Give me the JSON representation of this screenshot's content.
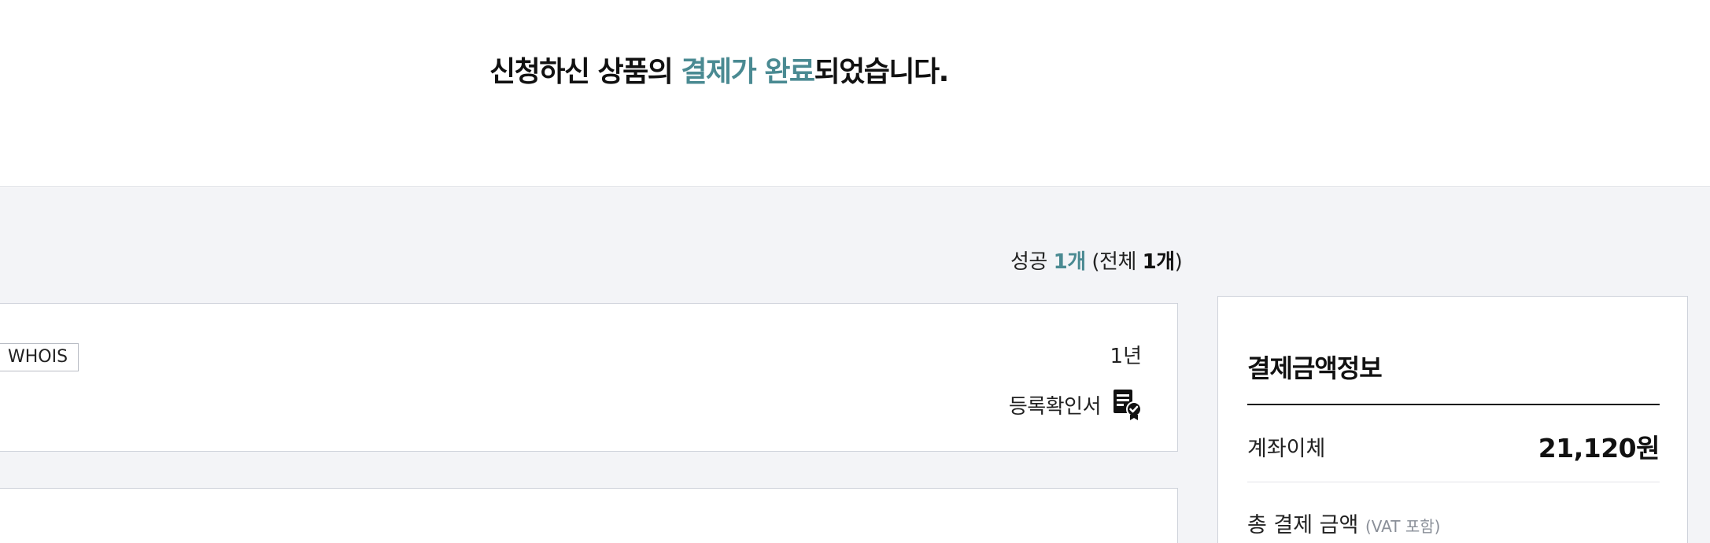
{
  "header": {
    "title_prefix": "신청하신 상품의 ",
    "title_highlight": "결제가 완료",
    "title_suffix": "되었습니다.",
    "accent_color": "#4a8a92"
  },
  "summary": {
    "success_label": "성공",
    "success_count": "1개",
    "total_open": "(전체",
    "total_count": "1개",
    "total_close": ")"
  },
  "product_card": {
    "tag": "WHOIS",
    "period": "1년",
    "certificate_label": "등록확인서",
    "certificate_icon": "certificate-icon"
  },
  "payment": {
    "title": "결제금액정보",
    "method": "계좌이체",
    "amount": "21,120원",
    "total_label": "총 결제 금액",
    "vat_note": "(VAT 포함)"
  }
}
